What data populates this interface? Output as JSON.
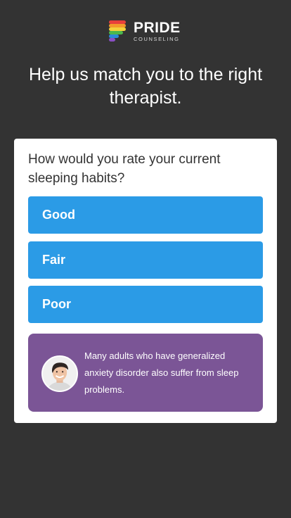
{
  "brand": {
    "name": "PRIDE",
    "tagline": "COUNSELING",
    "logo_colors": [
      "#e8403b",
      "#f39a2b",
      "#f3d23b",
      "#4cb84c",
      "#2b8ad8",
      "#8a4fc4"
    ]
  },
  "headline": "Help us match you to the right therapist.",
  "question": {
    "text": "How would you rate your current sleeping habits?",
    "options": [
      "Good",
      "Fair",
      "Poor"
    ]
  },
  "info": {
    "avatar_icon": "therapist-avatar",
    "text": "Many adults who have generalized anxiety disorder also suffer from sleep problems."
  },
  "colors": {
    "background": "#333333",
    "option_button": "#2b9be6",
    "info_panel": "#7b5596"
  }
}
